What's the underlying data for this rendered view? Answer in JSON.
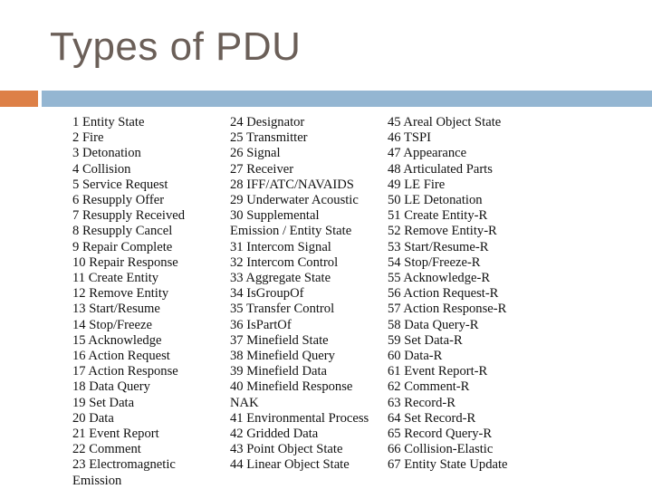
{
  "slide": {
    "title": "Types of PDU",
    "colors": {
      "accent_orange": "#dd8047",
      "accent_blue": "#94b6d2",
      "title_color": "#6b5f58"
    }
  },
  "columns": [
    [
      "1 Entity State",
      "2 Fire",
      "3 Detonation",
      "4 Collision",
      "5 Service Request",
      "6 Resupply Offer",
      "7 Resupply Received",
      "8 Resupply Cancel",
      "9 Repair Complete",
      "10 Repair Response",
      "11 Create Entity",
      "12 Remove Entity",
      "13 Start/Resume",
      "14 Stop/Freeze",
      "15 Acknowledge",
      "16 Action Request",
      "17 Action Response",
      "18 Data Query",
      "19 Set Data",
      "20 Data",
      "21 Event Report",
      "22 Comment",
      "23 Electromagnetic",
      "Emission"
    ],
    [
      "24 Designator",
      "25 Transmitter",
      "26 Signal",
      "27 Receiver",
      "28 IFF/ATC/NAVAIDS",
      "29 Underwater Acoustic",
      "30 Supplemental",
      "Emission / Entity State",
      "31 Intercom Signal",
      "32 Intercom Control",
      "33 Aggregate State",
      "34 IsGroupOf",
      "35 Transfer Control",
      "36 IsPartOf",
      "37 Minefield State",
      "38 Minefield Query",
      "39 Minefield Data",
      "40 Minefield Response",
      "NAK",
      "41 Environmental Process",
      "42 Gridded Data",
      "43 Point Object State",
      "44 Linear Object State"
    ],
    [
      "45 Areal Object State",
      "46 TSPI",
      "47 Appearance",
      "48 Articulated Parts",
      "49 LE Fire",
      "50 LE Detonation",
      "51 Create Entity-R",
      "52 Remove Entity-R",
      "53 Start/Resume-R",
      "54 Stop/Freeze-R",
      "55 Acknowledge-R",
      "56 Action Request-R",
      "57 Action Response-R",
      "58 Data Query-R",
      "59 Set Data-R",
      "60 Data-R",
      "61 Event Report-R",
      "62 Comment-R",
      "63 Record-R",
      "64 Set Record-R",
      "65 Record Query-R",
      "66 Collision-Elastic",
      "67 Entity State Update"
    ]
  ]
}
